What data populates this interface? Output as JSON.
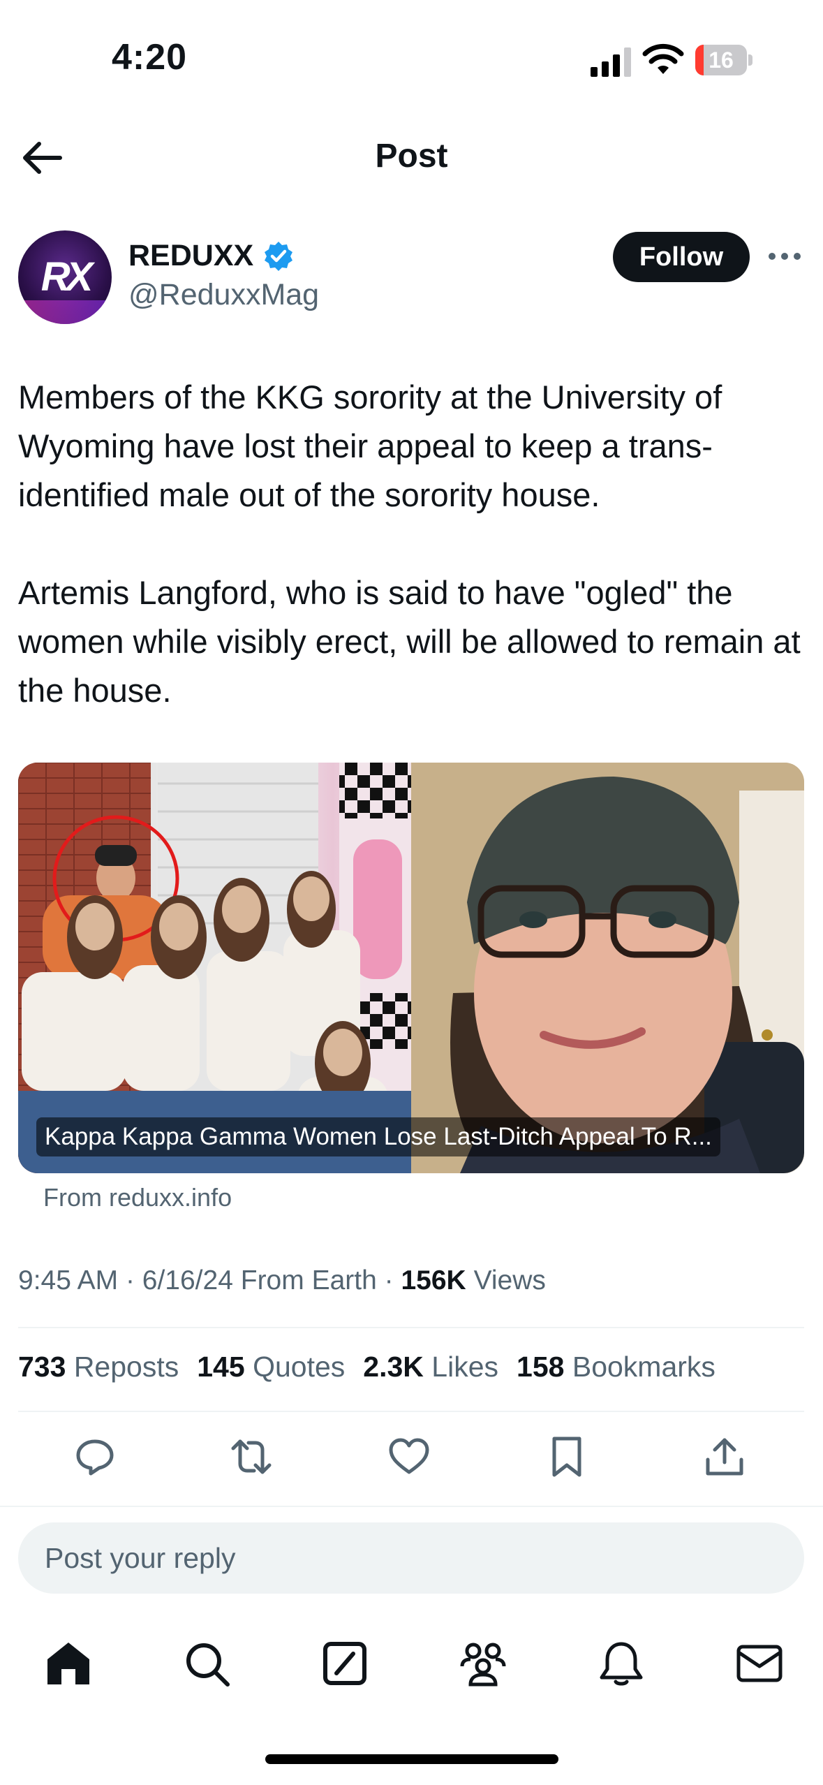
{
  "status_bar": {
    "time": "4:20",
    "battery_level": "16",
    "battery_fraction": 0.16
  },
  "header": {
    "title": "Post"
  },
  "author": {
    "avatar_text": "RX",
    "display_name": "REDUXX",
    "handle": "@ReduxxMag",
    "follow_label": "Follow"
  },
  "post": {
    "text": "Members of the KKG sorority at the University of Wyoming have lost their appeal to keep a trans-identified male out of the sorority house.\n\nArtemis Langford, who is said to have \"ogled\" the women while visibly erect, will be allowed to remain at the house.",
    "media_caption": "Kappa Kappa Gamma Women Lose Last-Ditch Appeal To R...",
    "source": "From reduxx.info"
  },
  "meta": {
    "time": "9:45 AM",
    "date": "6/16/24",
    "location": "From Earth",
    "views_count": "156K",
    "views_label": "Views",
    "separator": "·"
  },
  "stats": [
    {
      "num": "733",
      "label": "Reposts"
    },
    {
      "num": "145",
      "label": "Quotes"
    },
    {
      "num": "2.3K",
      "label": "Likes"
    },
    {
      "num": "158",
      "label": "Bookmarks"
    }
  ],
  "reply": {
    "placeholder": "Post your reply"
  },
  "colors": {
    "text": "#0f1419",
    "muted": "#536471",
    "verified": "#1d9bf0",
    "divider": "#eff3f4",
    "battery_low": "#ff3b30"
  },
  "icons": {
    "actions": [
      "reply-icon",
      "repost-icon",
      "like-icon",
      "bookmark-icon",
      "share-icon"
    ],
    "tabs": [
      "home-icon",
      "search-icon",
      "grok-icon",
      "communities-icon",
      "notifications-icon",
      "messages-icon"
    ]
  }
}
